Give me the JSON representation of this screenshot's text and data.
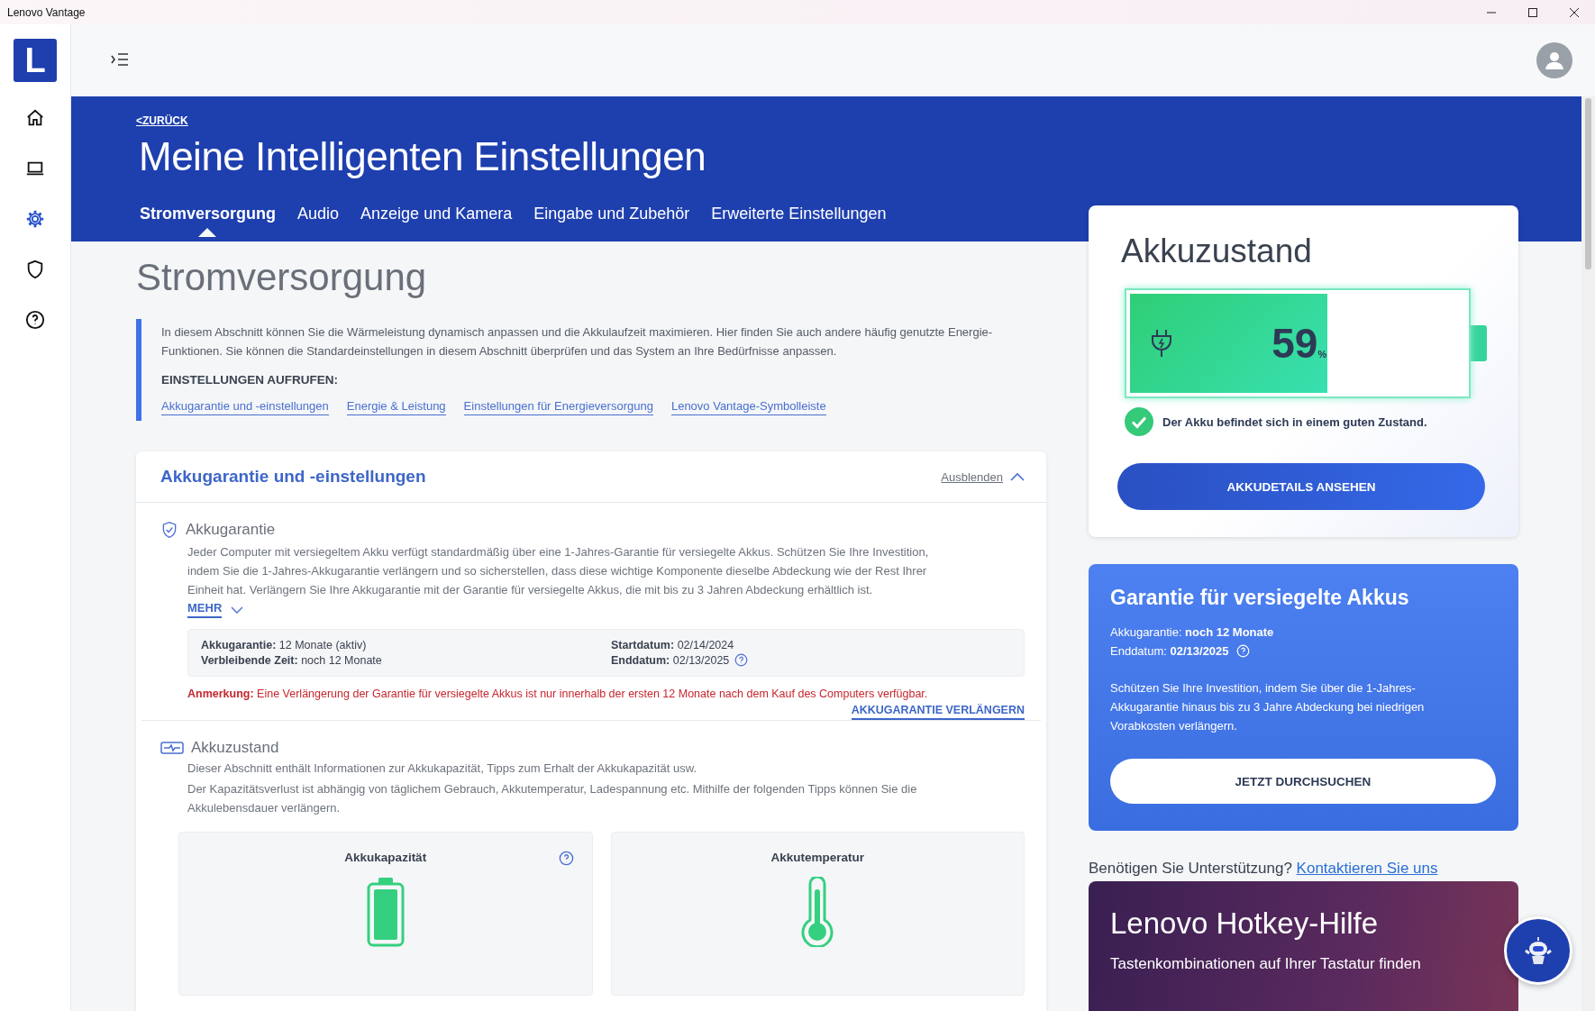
{
  "window": {
    "title": "Lenovo Vantage"
  },
  "app_logo": {
    "letter": "L"
  },
  "nav_items": [
    {
      "selected": false
    },
    {
      "selected": false
    },
    {
      "selected": true
    },
    {
      "selected": false
    },
    {
      "selected": false
    }
  ],
  "header": {
    "back_link": "<ZURÜCK",
    "title": "Meine Intelligenten Einstellungen"
  },
  "tabs": [
    {
      "label": "Stromversorgung",
      "selected": true
    },
    {
      "label": "Audio",
      "selected": false
    },
    {
      "label": "Anzeige und Kamera",
      "selected": false
    },
    {
      "label": "Eingabe und Zubehör",
      "selected": false
    },
    {
      "label": "Erweiterte Einstellungen",
      "selected": false
    }
  ],
  "page_title": "Stromversorgung",
  "intro": {
    "text": "In diesem Abschnitt können Sie die Wärmeleistung dynamisch anpassen und die Akkulaufzeit maximieren. Hier finden Sie auch andere häufig genutzte Energie-Funktionen. Sie können die Standardeinstellungen in diesem Abschnitt überprüfen und das System an Ihre Bedürfnisse anpassen.",
    "links_heading": "EINSTELLUNGEN AUFRUFEN:",
    "links": [
      "Akkugarantie und -einstellungen",
      "Energie & Leistung",
      "Einstellungen für Energieversorgung",
      "Lenovo Vantage-Symbolleiste"
    ]
  },
  "settings_card": {
    "title": "Akkugarantie und -einstellungen",
    "toggle": "Ausblenden",
    "expanded": true
  },
  "battery_warranty": {
    "title": "Akkugarantie",
    "text": "Jeder Computer mit versiegeltem Akku verfügt standardmäßig über eine 1-Jahres-Garantie für versiegelte Akkus. Schützen Sie Ihre Investition, indem Sie die 1-Jahres-Akkugarantie verlängern und so sicherstellen, dass diese wichtige Komponente dieselbe Abdeckung wie der Rest Ihrer Einheit hat. Verlängern Sie Ihre Akkugarantie mit der Garantie für versiegelte Akkus, die mit bis zu 3 Jahren Abdeckung erhältlich ist.",
    "more": "MEHR",
    "details": [
      {
        "label": "Akkugarantie:",
        "value": "12 Monate (aktiv)",
        "help": false
      },
      {
        "label": "Startdatum:",
        "value": "02/14/2024",
        "help": false
      },
      {
        "label": "Verbleibende Zeit:",
        "value": "noch 12 Monate",
        "help": false
      },
      {
        "label": "Enddatum:",
        "value": "02/13/2025",
        "help": true
      }
    ],
    "note_label": "Anmerkung:",
    "note": "Eine Verlängerung der Garantie für versiegelte Akkus ist nur innerhalb der ersten 12 Monate nach dem Kauf des Computers verfügbar.",
    "extend_link": "AKKUGARANTIE VERLÄNGERN"
  },
  "battery_health": {
    "title": "Akkuzustand",
    "lines": [
      "Dieser Abschnitt enthält Informationen zur Akkukapazität, Tipps zum Erhalt der Akkukapazität usw.",
      "Der Kapazitätsverlust ist abhängig von täglichem Gebrauch, Akkutemperatur, Ladespannung etc. Mithilfe der folgenden Tipps können Sie die Akkulebensdauer verlängern."
    ],
    "tiles": [
      {
        "title": "Akkukapazität",
        "help": true,
        "kind": "capacity"
      },
      {
        "title": "Akkutemperatur",
        "help": false,
        "kind": "temperature"
      }
    ]
  },
  "battery_card": {
    "title": "Akkuzustand",
    "level": 0.59,
    "percent": "59",
    "unit": "%",
    "charging": true,
    "status": "Der Akku befindet sich in einem guten Zustand.",
    "button": "AKKUDETAILS ANSEHEN"
  },
  "promo_card": {
    "title": "Garantie für versiegelte Akkus",
    "lines": [
      {
        "label": "Akkugarantie:",
        "value": "noch 12 Monate",
        "help": false
      },
      {
        "label": "Enddatum:",
        "value": "02/13/2025",
        "help": true
      }
    ],
    "text": "Schützen Sie Ihre Investition, indem Sie über die 1-Jahres-Akkugarantie hinaus bis zu 3 Jahre Abdeckung bei niedrigen Vorabkosten verlängern.",
    "button": "JETZT DURCHSUCHEN"
  },
  "support": {
    "text": "Benötigen Sie Unterstützung?",
    "link": "Kontaktieren Sie uns"
  },
  "hotkey_card": {
    "title": "Lenovo Hotkey-Hilfe",
    "subtitle": "Tastenkombinationen auf Ihrer Tastatur finden"
  }
}
